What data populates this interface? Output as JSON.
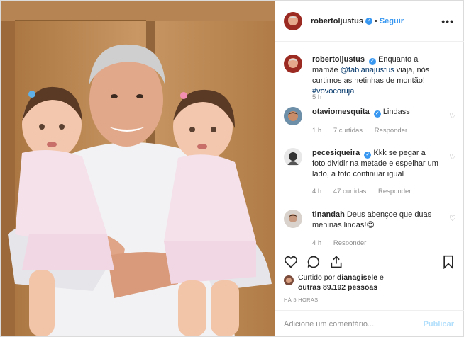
{
  "post": {
    "author": "robertoljustus",
    "follow_label": "Seguir",
    "separator": "•",
    "more_label": "•••"
  },
  "caption": {
    "author": "robertoljustus",
    "text_before": "Enquanto a mamãe ",
    "mention": "@fabianajustus",
    "text_after": " viaja, nós curtimos as netinhas de montão! ",
    "hashtag": "#vovocoruja",
    "time": "5 h"
  },
  "comments": [
    {
      "user": "otaviomesquita",
      "verified": true,
      "text": "Lindass",
      "time": "1 h",
      "likes": "7 curtidas",
      "reply": "Responder"
    },
    {
      "user": "pecesiqueira",
      "verified": true,
      "text": "Kkk se pegar a foto dividir na metade e espelhar um lado, a foto continuar igual",
      "time": "4 h",
      "likes": "47 curtidas",
      "reply": "Responder"
    },
    {
      "user": "tinandah",
      "verified": false,
      "text": "Deus abençoe que duas meninas lindas!😍",
      "time": "4 h",
      "likes": "",
      "reply": "Responder"
    }
  ],
  "likes": {
    "prefix": "Curtido por ",
    "user": "dianagisele",
    "middle": " e",
    "others": "outras 89.192 pessoas"
  },
  "timestamp": "HÁ 5 HORAS",
  "add_comment": {
    "placeholder": "Adicione um comentário...",
    "publish": "Publicar"
  },
  "icons": {
    "heart": "heart-icon",
    "comment": "comment-icon",
    "share": "share-icon",
    "save": "bookmark-icon",
    "verified": "verified-badge-icon",
    "more": "more-options-icon"
  },
  "colors": {
    "accent": "#3897f0",
    "muted": "#8e8e8e",
    "border": "#efefef",
    "publish_disabled": "#b2dffc"
  }
}
